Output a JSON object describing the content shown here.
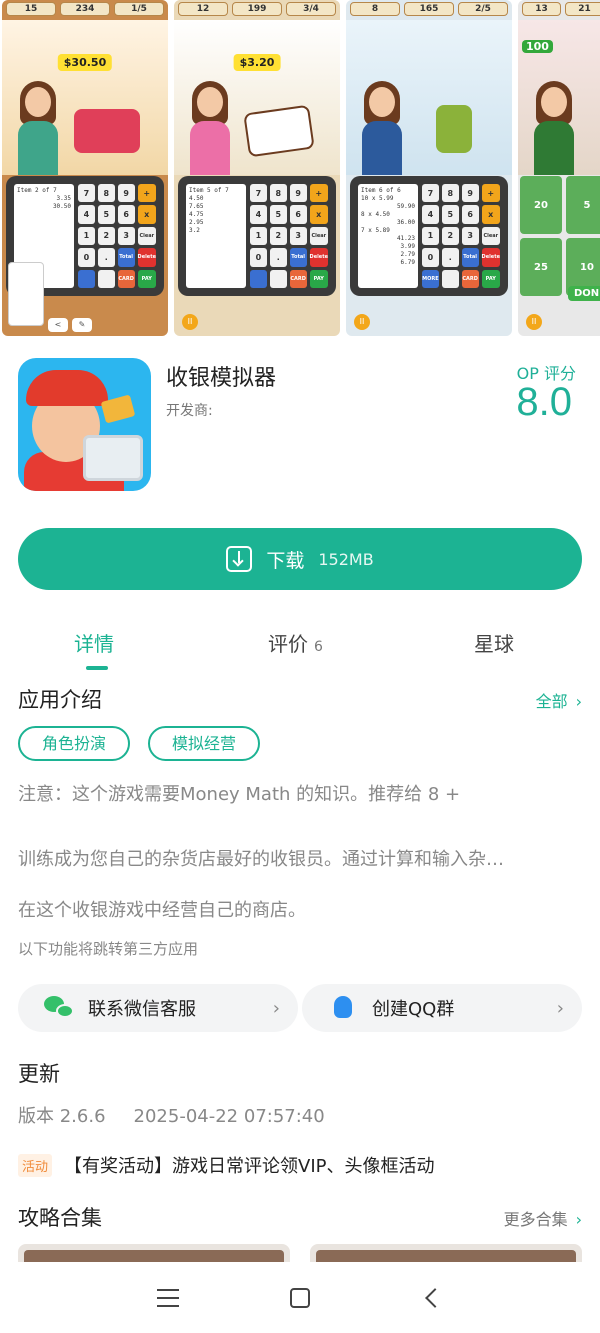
{
  "screenshots": [
    {
      "hud": [
        "15",
        "234",
        "1/5"
      ],
      "price": "$30.50",
      "receipt": [
        "Item 2 of 7",
        "3.35",
        "30.50"
      ]
    },
    {
      "hud": [
        "12",
        "199",
        "3/4"
      ],
      "price": "$3.20",
      "receipt": [
        "Item 5 of 7",
        "4.50",
        "7.65",
        "4.75",
        "2.95",
        "3.2"
      ]
    },
    {
      "hud": [
        "8",
        "165",
        "2/5"
      ],
      "price": "",
      "receipt": [
        "Item 6 of 6",
        "10 x 5.99",
        "59.90",
        "8 x 4.50",
        "36.00",
        "7 x 5.89",
        "41.23",
        "3.99",
        "2.79",
        "6.79"
      ]
    },
    {
      "hud": [
        "13",
        "21"
      ],
      "score": "100",
      "done": "DONE"
    }
  ],
  "keypad": {
    "keys": [
      "7",
      "8",
      "9",
      "+",
      "4",
      "5",
      "6",
      "x",
      "1",
      "2",
      "3",
      "Clear",
      "0",
      ".",
      "Total",
      "Delete"
    ],
    "extra": [
      "MORE",
      "CARD",
      "PAY"
    ]
  },
  "app": {
    "name": "收银模拟器",
    "developer_label": "开发商:",
    "score_label": "OP 评分",
    "score": "8.0"
  },
  "download": {
    "label": "下载",
    "size": "152MB"
  },
  "tabs": [
    {
      "label": "详情",
      "active": true
    },
    {
      "label": "评价",
      "count": "6"
    },
    {
      "label": "星球"
    }
  ],
  "intro": {
    "title": "应用介绍",
    "all_link": "全部",
    "tags": [
      "角色扮演",
      "模拟经营"
    ],
    "lines": [
      "注意：这个游戏需要Money Math 的知识。推荐给 8 +",
      "训练成为您自己的杂货店最好的收银员。通过计算和输入杂…",
      "在这个收银游戏中经营自己的商店。"
    ],
    "third_party_note": "以下功能将跳转第三方应用"
  },
  "contacts": [
    {
      "label": "联系微信客服",
      "icon": "wechat-icon"
    },
    {
      "label": "创建QQ群",
      "icon": "qq-icon"
    }
  ],
  "update": {
    "title": "更新",
    "version": "版本 2.6.6",
    "date": "2025-04-22 07:57:40",
    "event_badge": "活动",
    "event_text": "【有奖活动】游戏日常评论领VIP、头像框活动"
  },
  "guides": {
    "title": "攻略合集",
    "more_link": "更多合集"
  },
  "colors": {
    "accent": "#1cb393",
    "event": "#f08b3a"
  }
}
